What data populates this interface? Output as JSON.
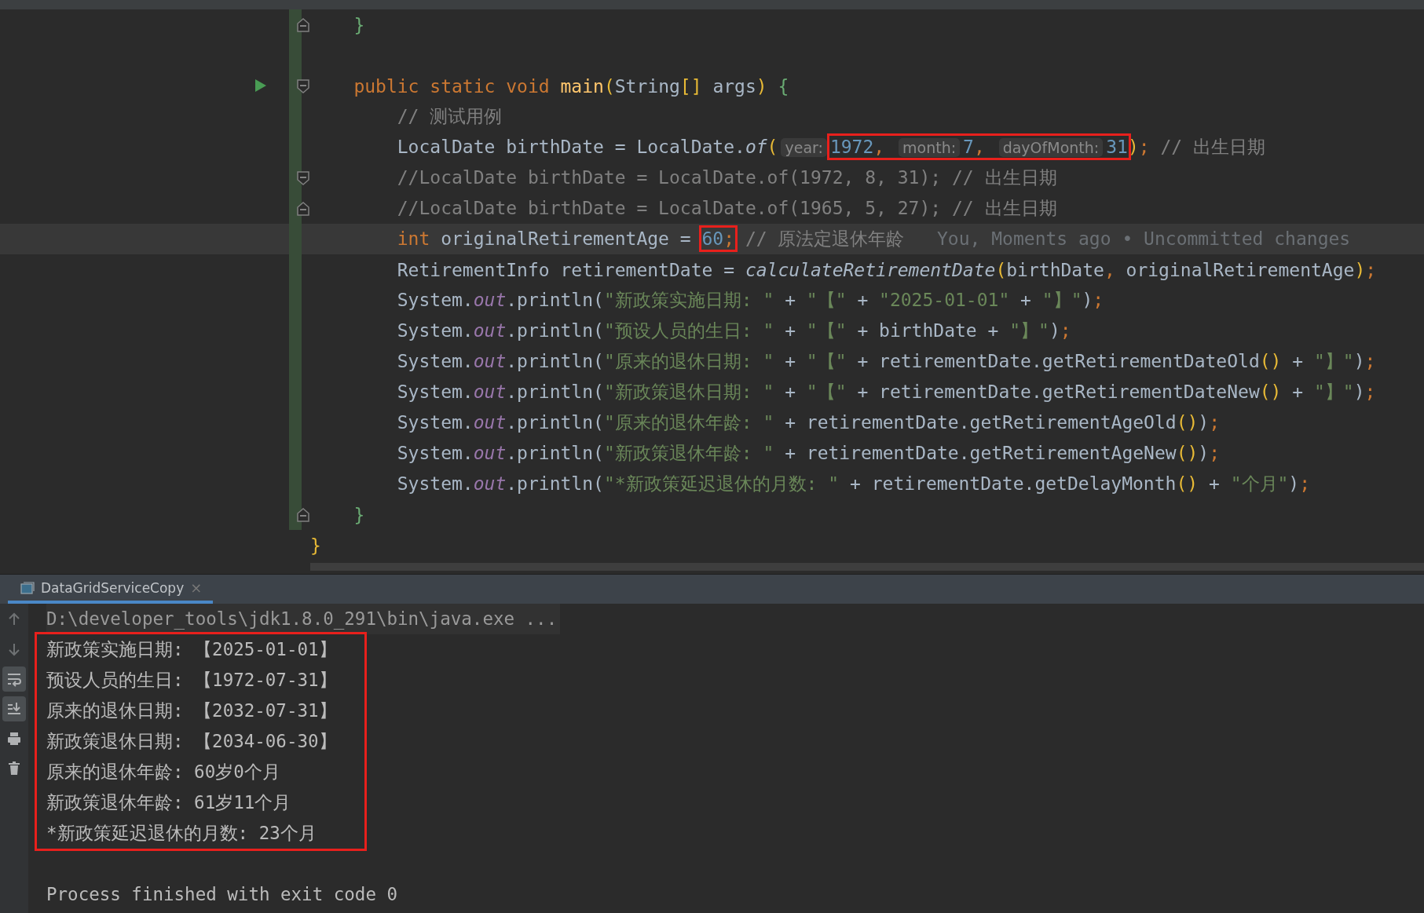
{
  "editor": {
    "lines": [
      {
        "markers": [
          {
            "kind": "fold-end"
          }
        ],
        "changed": true,
        "current": false,
        "tokens": [
          {
            "t": "    }",
            "kind": "br"
          }
        ]
      },
      {
        "changed": true,
        "current": false
      },
      {
        "markers": [
          {
            "kind": "run"
          },
          {
            "kind": "fold-start"
          }
        ],
        "changed": true,
        "current": false,
        "tokens": [
          {
            "t": "    public static void ",
            "kind": "kw"
          },
          {
            "t": "main",
            "kind": "fn"
          },
          {
            "t": "(",
            "kind": "pr"
          },
          {
            "t": "String",
            "kind": "p"
          },
          {
            "t": "[]",
            "kind": "pr"
          },
          {
            "t": " args",
            "kind": "p"
          },
          {
            "t": ")",
            "kind": "pr"
          },
          {
            "t": " {",
            "kind": "br"
          }
        ]
      },
      {
        "changed": true,
        "current": false,
        "tokens": [
          {
            "t": "        // 测试用例",
            "kind": "cm"
          }
        ]
      },
      {
        "changed": true,
        "current": false,
        "tokens": [
          {
            "t": "        LocalDate birthDate = LocalDate.",
            "kind": "p"
          },
          {
            "t": "of",
            "kind": "it"
          },
          {
            "t": "(",
            "kind": "pr"
          },
          {
            "t": "year:",
            "kind": "hint"
          },
          {
            "kind": "box",
            "tokens": [
              {
                "t": "1972",
                "kind": "num"
              },
              {
                "t": ", ",
                "kind": "punc"
              },
              {
                "t": "month:",
                "kind": "hint"
              },
              {
                "t": "7",
                "kind": "num"
              },
              {
                "t": ", ",
                "kind": "punc"
              },
              {
                "t": "dayOfMonth:",
                "kind": "hint"
              },
              {
                "t": "31",
                "kind": "num"
              }
            ]
          },
          {
            "t": ")",
            "kind": "pr"
          },
          {
            "t": ";",
            "kind": "punc"
          },
          {
            "t": " // 出生日期",
            "kind": "cm"
          }
        ]
      },
      {
        "markers": [
          {
            "kind": "fold-start"
          }
        ],
        "changed": true,
        "current": false,
        "tokens": [
          {
            "t": "        //LocalDate birthDate = LocalDate.of(1972, 8, 31); // 出生日期",
            "kind": "cm"
          }
        ]
      },
      {
        "markers": [
          {
            "kind": "fold-end"
          }
        ],
        "changed": true,
        "current": false,
        "tokens": [
          {
            "t": "        //LocalDate birthDate = LocalDate.of(1965, 5, 27); // 出生日期",
            "kind": "cm"
          }
        ]
      },
      {
        "changed": true,
        "current": true,
        "tokens": [
          {
            "t": "        int",
            "kind": "kw"
          },
          {
            "t": " originalRetirementAge = ",
            "kind": "p"
          },
          {
            "kind": "box",
            "tokens": [
              {
                "t": "60",
                "kind": "num"
              },
              {
                "t": ";",
                "kind": "punc"
              }
            ]
          },
          {
            "t": " // 原法定退休年龄",
            "kind": "cm"
          },
          {
            "t": "   You, Moments ago • Uncommitted changes",
            "kind": "blame"
          }
        ]
      },
      {
        "changed": true,
        "current": false,
        "tokens": [
          {
            "t": "        RetirementInfo retirementDate = ",
            "kind": "p"
          },
          {
            "t": "calculateRetirementDate",
            "kind": "it"
          },
          {
            "t": "(",
            "kind": "pr"
          },
          {
            "t": "birthDate",
            "kind": "p"
          },
          {
            "t": ", ",
            "kind": "punc"
          },
          {
            "t": "originalRetirementAge",
            "kind": "p"
          },
          {
            "t": ")",
            "kind": "pr"
          },
          {
            "t": ";",
            "kind": "punc"
          }
        ]
      },
      {
        "changed": true,
        "current": false,
        "tokens": [
          {
            "t": "        System.",
            "kind": "p"
          },
          {
            "t": "out",
            "kind": "fld"
          },
          {
            "t": ".println(",
            "kind": "p"
          },
          {
            "t": "\"新政策实施日期: \"",
            "kind": "str"
          },
          {
            "t": " + ",
            "kind": "p"
          },
          {
            "t": "\"【\"",
            "kind": "str"
          },
          {
            "t": " + ",
            "kind": "p"
          },
          {
            "t": "\"2025-01-01\"",
            "kind": "str"
          },
          {
            "t": " + ",
            "kind": "p"
          },
          {
            "t": "\"】\"",
            "kind": "str"
          },
          {
            "t": ")",
            "kind": "p"
          },
          {
            "t": ";",
            "kind": "punc"
          }
        ]
      },
      {
        "changed": true,
        "current": false,
        "tokens": [
          {
            "t": "        System.",
            "kind": "p"
          },
          {
            "t": "out",
            "kind": "fld"
          },
          {
            "t": ".println(",
            "kind": "p"
          },
          {
            "t": "\"预设人员的生日: \"",
            "kind": "str"
          },
          {
            "t": " + ",
            "kind": "p"
          },
          {
            "t": "\"【\"",
            "kind": "str"
          },
          {
            "t": " + birthDate + ",
            "kind": "p"
          },
          {
            "t": "\"】\"",
            "kind": "str"
          },
          {
            "t": ")",
            "kind": "p"
          },
          {
            "t": ";",
            "kind": "punc"
          }
        ]
      },
      {
        "changed": true,
        "current": false,
        "tokens": [
          {
            "t": "        System.",
            "kind": "p"
          },
          {
            "t": "out",
            "kind": "fld"
          },
          {
            "t": ".println(",
            "kind": "p"
          },
          {
            "t": "\"原来的退休日期: \"",
            "kind": "str"
          },
          {
            "t": " + ",
            "kind": "p"
          },
          {
            "t": "\"【\"",
            "kind": "str"
          },
          {
            "t": " + retirementDate.getRetirementDateOld",
            "kind": "p"
          },
          {
            "t": "()",
            "kind": "pr"
          },
          {
            "t": " + ",
            "kind": "p"
          },
          {
            "t": "\"】\"",
            "kind": "str"
          },
          {
            "t": ")",
            "kind": "p"
          },
          {
            "t": ";",
            "kind": "punc"
          }
        ]
      },
      {
        "changed": true,
        "current": false,
        "tokens": [
          {
            "t": "        System.",
            "kind": "p"
          },
          {
            "t": "out",
            "kind": "fld"
          },
          {
            "t": ".println(",
            "kind": "p"
          },
          {
            "t": "\"新政策退休日期: \"",
            "kind": "str"
          },
          {
            "t": " + ",
            "kind": "p"
          },
          {
            "t": "\"【\"",
            "kind": "str"
          },
          {
            "t": " + retirementDate.getRetirementDateNew",
            "kind": "p"
          },
          {
            "t": "()",
            "kind": "pr"
          },
          {
            "t": " + ",
            "kind": "p"
          },
          {
            "t": "\"】\"",
            "kind": "str"
          },
          {
            "t": ")",
            "kind": "p"
          },
          {
            "t": ";",
            "kind": "punc"
          }
        ]
      },
      {
        "changed": true,
        "current": false,
        "tokens": [
          {
            "t": "        System.",
            "kind": "p"
          },
          {
            "t": "out",
            "kind": "fld"
          },
          {
            "t": ".println(",
            "kind": "p"
          },
          {
            "t": "\"原来的退休年龄: \"",
            "kind": "str"
          },
          {
            "t": " + retirementDate.getRetirementAgeOld",
            "kind": "p"
          },
          {
            "t": "()",
            "kind": "pr"
          },
          {
            "t": ")",
            "kind": "p"
          },
          {
            "t": ";",
            "kind": "punc"
          }
        ]
      },
      {
        "changed": true,
        "current": false,
        "tokens": [
          {
            "t": "        System.",
            "kind": "p"
          },
          {
            "t": "out",
            "kind": "fld"
          },
          {
            "t": ".println(",
            "kind": "p"
          },
          {
            "t": "\"新政策退休年龄: \"",
            "kind": "str"
          },
          {
            "t": " + retirementDate.getRetirementAgeNew",
            "kind": "p"
          },
          {
            "t": "()",
            "kind": "pr"
          },
          {
            "t": ")",
            "kind": "p"
          },
          {
            "t": ";",
            "kind": "punc"
          }
        ]
      },
      {
        "changed": true,
        "current": false,
        "tokens": [
          {
            "t": "        System.",
            "kind": "p"
          },
          {
            "t": "out",
            "kind": "fld"
          },
          {
            "t": ".println(",
            "kind": "p"
          },
          {
            "t": "\"*新政策延迟退休的月数: \"",
            "kind": "str"
          },
          {
            "t": " + retirementDate.getDelayMonth",
            "kind": "p"
          },
          {
            "t": "()",
            "kind": "pr"
          },
          {
            "t": " + ",
            "kind": "p"
          },
          {
            "t": "\"个月\"",
            "kind": "str"
          },
          {
            "t": ")",
            "kind": "p"
          },
          {
            "t": ";",
            "kind": "punc"
          }
        ]
      },
      {
        "markers": [
          {
            "kind": "fold-end"
          }
        ],
        "changed": true,
        "current": false,
        "tokens": [
          {
            "t": "    }",
            "kind": "br"
          }
        ]
      },
      {
        "changed": false,
        "current": false,
        "tokens": [
          {
            "t": "}",
            "kind": "pr"
          }
        ]
      }
    ]
  },
  "run_panel": {
    "tab": {
      "label": "DataGridServiceCopy",
      "close": "×",
      "selected": true
    },
    "toolbar": [
      {
        "kind": "up",
        "selected": false
      },
      {
        "kind": "down",
        "selected": false
      },
      {
        "kind": "wrap",
        "selected": true
      },
      {
        "kind": "scroll-end",
        "selected": true
      },
      {
        "kind": "print",
        "selected": false
      },
      {
        "kind": "trash",
        "selected": false
      }
    ],
    "output": [
      {
        "kind": "command",
        "text": "D:\\developer_tools\\jdk1.8.0_291\\bin\\java.exe ..."
      },
      {
        "kind": "box",
        "lines": [
          {
            "kind": "output",
            "text": "新政策实施日期: 【2025-01-01】"
          },
          {
            "kind": "output",
            "text": "预设人员的生日: 【1972-07-31】"
          },
          {
            "kind": "output",
            "text": "原来的退休日期: 【2032-07-31】"
          },
          {
            "kind": "output",
            "text": "新政策退休日期: 【2034-06-30】"
          },
          {
            "kind": "output",
            "text": "原来的退休年龄: 60岁0个月"
          },
          {
            "kind": "output",
            "text": "新政策退休年龄: 61岁11个月"
          },
          {
            "kind": "output",
            "text": "*新政策延迟退休的月数: 23个月"
          }
        ]
      },
      {
        "kind": "blank"
      },
      {
        "kind": "output",
        "text": "Process finished with exit code 0"
      }
    ]
  }
}
